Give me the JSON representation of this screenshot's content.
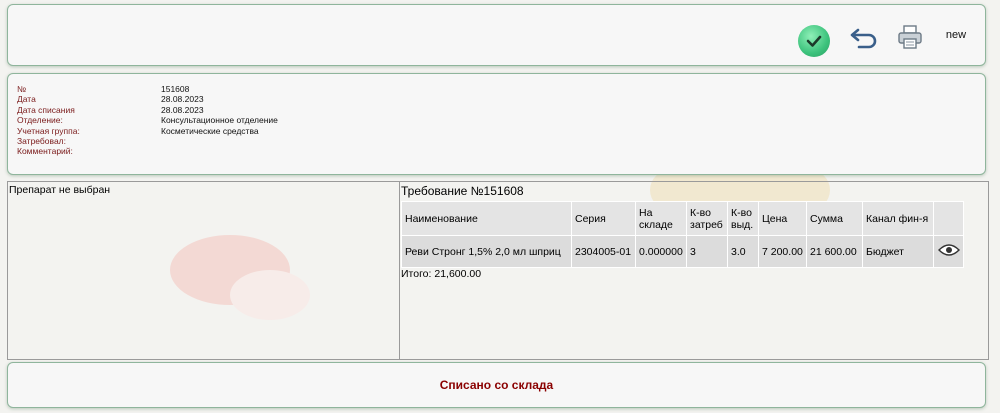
{
  "toolbar": {
    "approve_icon": "check-circle-icon",
    "undo_icon": "undo-arrow-icon",
    "print_icon": "printer-icon",
    "new_label": "new"
  },
  "info": {
    "rows": [
      {
        "label": "№",
        "value": "151608"
      },
      {
        "label": "Дата",
        "value": "28.08.2023"
      },
      {
        "label": "Дата списания",
        "value": "28.08.2023"
      },
      {
        "label": "Отделение:",
        "value": "Консультационное отделение"
      },
      {
        "label": "Учетная группа:",
        "value": "Косметические средства"
      },
      {
        "label": "Затребовал:",
        "value": ""
      },
      {
        "label": "Комментарий:",
        "value": ""
      }
    ]
  },
  "left_pane": {
    "message": "Препарат не выбран"
  },
  "right_pane": {
    "title": "Требование №151608",
    "columns": [
      "Наименование",
      "Серия",
      "На складе",
      "К-во затреб",
      "К-во выд.",
      "Цена",
      "Сумма",
      "Канал фин-я",
      ""
    ],
    "rows": [
      {
        "name": "Реви Стронг 1,5% 2,0 мл шприц",
        "series": "2304005-01",
        "stock": "0.000000",
        "requested": "3",
        "issued": "3.0",
        "price": "7 200.00",
        "sum": "21 600.00",
        "channel": "Бюджет"
      }
    ],
    "total": "Итого: 21,600.00"
  },
  "status": {
    "text": "Списано со склада"
  },
  "colors": {
    "accent_green": "#3cc27c",
    "status_red": "#8a0000",
    "label_red": "#7a1a1a"
  }
}
